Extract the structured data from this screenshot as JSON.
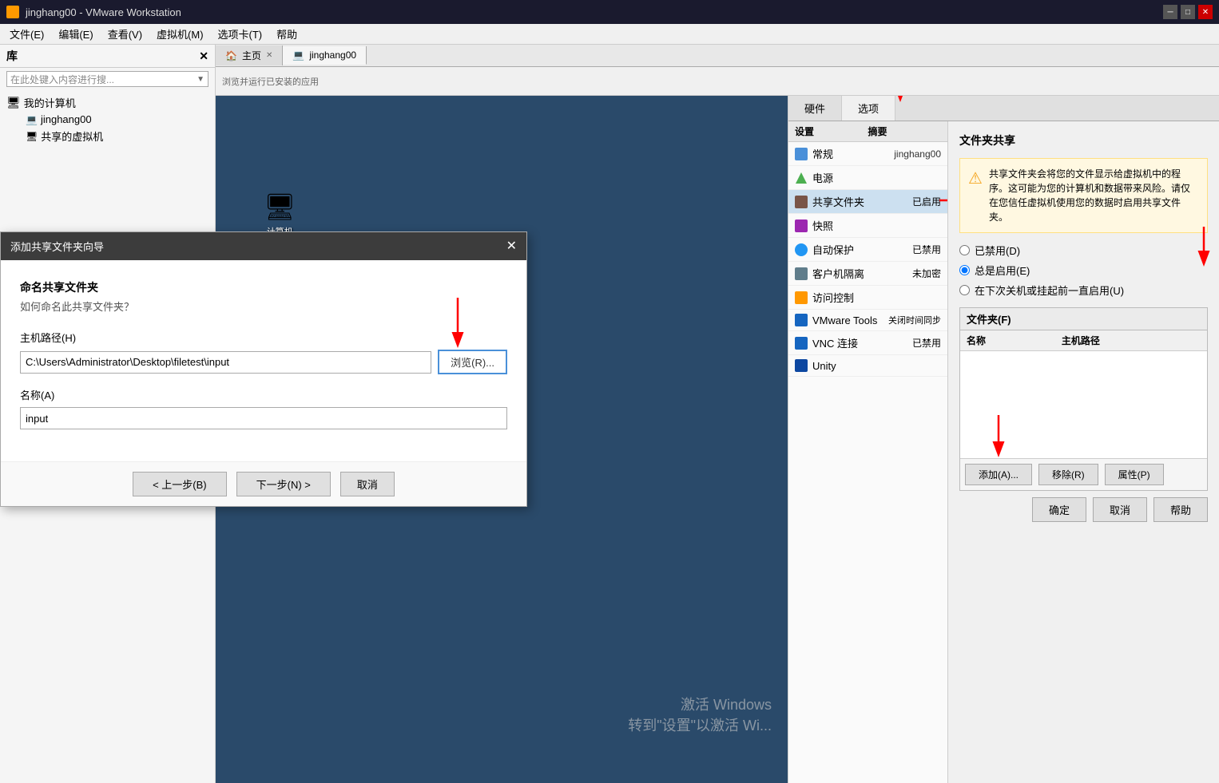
{
  "window": {
    "title": "jinghang00 - VMware Workstation",
    "icon": "vmware"
  },
  "menubar": {
    "items": [
      "文件(E)",
      "编辑(E)",
      "查看(V)",
      "虚拟机(M)",
      "选项卡(T)",
      "帮助"
    ]
  },
  "sidebar": {
    "title": "库",
    "search_placeholder": "在此处键入内容进行搜... ",
    "tree": [
      {
        "label": "我的计算机",
        "type": "computer",
        "expanded": true
      },
      {
        "label": "jinghang00",
        "type": "vm",
        "indent": true
      },
      {
        "label": "共享的虚拟机",
        "type": "shared",
        "indent": true
      }
    ]
  },
  "vm_tabs": [
    {
      "label": "主页",
      "closable": true,
      "active": false
    },
    {
      "label": "jinghang00",
      "closable": false,
      "active": true
    }
  ],
  "vm_toolbar_text": "浏览并运行已安装的应用",
  "settings": {
    "tabs": [
      {
        "label": "硬件",
        "active": false
      },
      {
        "label": "选项",
        "active": true
      }
    ],
    "list_headers": {
      "settings": "设置",
      "summary": "摘要"
    },
    "items": [
      {
        "label": "常规",
        "summary": "jinghang00",
        "selected": false
      },
      {
        "label": "电源",
        "summary": "",
        "selected": false
      },
      {
        "label": "共享文件夹",
        "summary": "已启用",
        "selected": true
      },
      {
        "label": "快照",
        "summary": "",
        "selected": false
      },
      {
        "label": "自动保护",
        "summary": "已禁用",
        "selected": false
      },
      {
        "label": "客户机隔离",
        "summary": "未加密",
        "selected": false
      },
      {
        "label": "访问控制",
        "summary": "",
        "selected": false
      },
      {
        "label": "VMware Tools",
        "summary": "关闭时间同步",
        "selected": false
      },
      {
        "label": "VNC 连接",
        "summary": "已禁用",
        "selected": false
      },
      {
        "label": "Unity",
        "summary": "",
        "selected": false
      }
    ]
  },
  "file_sharing_panel": {
    "title": "文件夹共享",
    "warning_text": "共享文件夹会将您的文件显示给虚拟机中的程序。这可能为您的计算机和数据带来风险。请仅在您信任虚拟机使用您的数据时启用共享文件夹。",
    "radio_options": [
      {
        "label": "已禁用(D)",
        "value": "disabled",
        "checked": false
      },
      {
        "label": "总是启用(E)",
        "value": "always",
        "checked": true
      },
      {
        "label": "在下次关机或挂起前一直启用(U)",
        "value": "untiloff",
        "checked": false
      }
    ],
    "folder_section_title": "文件夹(F)",
    "table_headers": [
      "名称",
      "主机路径"
    ],
    "buttons": {
      "add": "添加(A)...",
      "remove": "移除(R)",
      "properties": "属性(P)"
    },
    "bottom_buttons": {
      "ok": "确定",
      "cancel": "取消",
      "help": "帮助"
    }
  },
  "wizard": {
    "title": "添加共享文件夹向导",
    "heading": "命名共享文件夹",
    "subheading": "如何命名此共享文件夹？",
    "host_path_label": "主机路径(H)",
    "host_path_value": "C:\\Users\\Administrator\\Desktop\\filetest\\input",
    "browse_button": "浏览(R)...",
    "name_label": "名称(A)",
    "name_value": "input",
    "nav_buttons": {
      "prev": "< 上一步(B)",
      "next": "下一步(N) >",
      "cancel": "取消"
    }
  },
  "watermark": {
    "line1": "激活 Windows",
    "line2": "转到\"设置\"以激活 Wi..."
  }
}
